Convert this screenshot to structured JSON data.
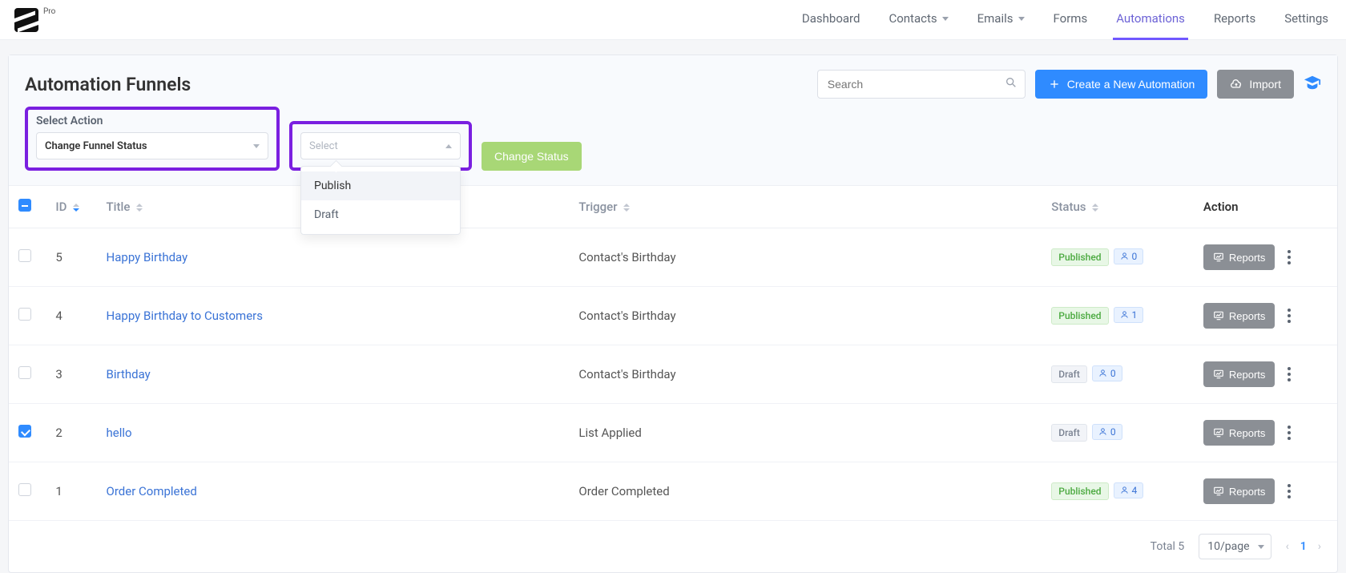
{
  "brand": {
    "badge": "Pro"
  },
  "nav": {
    "dashboard": "Dashboard",
    "contacts": "Contacts",
    "emails": "Emails",
    "forms": "Forms",
    "automations": "Automations",
    "reports": "Reports",
    "settings": "Settings"
  },
  "page": {
    "title": "Automation Funnels",
    "search_placeholder": "Search",
    "create_btn": "Create a New Automation",
    "import_btn": "Import"
  },
  "action_bar": {
    "label": "Select Action",
    "action_value": "Change Funnel Status",
    "status_placeholder": "Select",
    "change_btn": "Change Status",
    "options": {
      "publish": "Publish",
      "draft": "Draft"
    }
  },
  "columns": {
    "id": "ID",
    "title": "Title",
    "trigger": "Trigger",
    "status": "Status",
    "action": "Action"
  },
  "statuses": {
    "published": "Published",
    "draft": "Draft"
  },
  "row_action": "Reports",
  "rows": [
    {
      "id": "5",
      "title": "Happy Birthday",
      "trigger": "Contact's Birthday",
      "status": "published",
      "subs": "0",
      "checked": false
    },
    {
      "id": "4",
      "title": "Happy Birthday to Customers",
      "trigger": "Contact's Birthday",
      "status": "published",
      "subs": "1",
      "checked": false
    },
    {
      "id": "3",
      "title": "Birthday",
      "trigger": "Contact's Birthday",
      "status": "draft",
      "subs": "0",
      "checked": false
    },
    {
      "id": "2",
      "title": "hello",
      "trigger": "List Applied",
      "status": "draft",
      "subs": "0",
      "checked": true
    },
    {
      "id": "1",
      "title": "Order Completed",
      "trigger": "Order Completed",
      "status": "published",
      "subs": "4",
      "checked": false
    }
  ],
  "footer": {
    "total_label": "Total 5",
    "page_size": "10/page",
    "current_page": "1"
  }
}
